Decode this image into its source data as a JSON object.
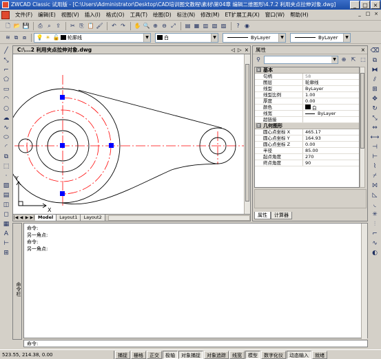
{
  "window": {
    "title": "ZWCAD Classic 试用版 - [C:\\Users\\Administrator\\Desktop\\CAD培训图文教程\\素材\\第04章 编辑二维图形\\4.7.2    利用夹点拉伸对象.dwg]",
    "controls": [
      "_",
      "□",
      "×"
    ]
  },
  "menu": {
    "items": [
      "文件(F)",
      "编辑(E)",
      "视图(V)",
      "插入(I)",
      "格式(O)",
      "工具(T)",
      "绘图(D)",
      "标注(N)",
      "修改(M)",
      "ET扩展工具(X)",
      "窗口(W)",
      "帮助(H)"
    ],
    "mdi_controls": [
      "_",
      "□",
      "×"
    ]
  },
  "toolbar": {
    "layer": "轮廓线",
    "color": "白",
    "linetype": "ByLayer",
    "lineweight": "ByLayer"
  },
  "document": {
    "tab_label": "C:\\...2  利用夹点拉伸对象.dwg",
    "controls": [
      "◁",
      "▷",
      "×"
    ]
  },
  "layouts": {
    "tabs": [
      "Model",
      "Layout1",
      "Layout2"
    ],
    "active": "Model"
  },
  "ucs": {
    "x_label": "X",
    "y_label": "Y"
  },
  "properties": {
    "title": "属性",
    "selection": "",
    "sections": [
      {
        "name": "基本",
        "toggle": "⊟",
        "rows": [
          {
            "key": "句柄",
            "value": "58",
            "muted": true
          },
          {
            "key": "图层",
            "value": "轮廓线"
          },
          {
            "key": "线型",
            "value": "ByLayer"
          },
          {
            "key": "线型比例",
            "value": "1.00"
          },
          {
            "key": "厚度",
            "value": "0.00"
          },
          {
            "key": "颜色",
            "value": "白",
            "swatch": "#000000"
          },
          {
            "key": "线宽",
            "value": "ByLayer",
            "line": true
          },
          {
            "key": "超链接",
            "value": ""
          }
        ]
      },
      {
        "name": "几何图形",
        "toggle": "⊟",
        "rows": [
          {
            "key": "圆心点坐标 X",
            "value": "465.17"
          },
          {
            "key": "圆心点坐标 Y",
            "value": "164.93"
          },
          {
            "key": "圆心点坐标 Z",
            "value": "0.00"
          },
          {
            "key": "半径",
            "value": "85.00"
          },
          {
            "key": "起点角度",
            "value": "270"
          },
          {
            "key": "终点角度",
            "value": "90"
          }
        ]
      }
    ],
    "tabs": [
      "属性",
      "计算器"
    ],
    "active_tab": "属性"
  },
  "command": {
    "side_label": "命令栏",
    "history": [
      "命令:",
      "另一角点:",
      "命令:",
      "另一角点:"
    ],
    "prompt": "命令:"
  },
  "status": {
    "coords": "523.55,  214.38,  0.00",
    "buttons": [
      {
        "label": "捕捉",
        "on": false
      },
      {
        "label": "栅格",
        "on": false
      },
      {
        "label": "正交",
        "on": false
      },
      {
        "label": "极轴",
        "on": true
      },
      {
        "label": "对象捕捉",
        "on": true
      },
      {
        "label": "对象追踪",
        "on": false
      },
      {
        "label": "线宽",
        "on": false
      },
      {
        "label": "模型",
        "on": true
      },
      {
        "label": "数字化仪",
        "on": false
      },
      {
        "label": "动态输入",
        "on": true
      },
      {
        "label": "就绪",
        "on": false
      }
    ]
  },
  "colors": {
    "titlebar": "#1d4fa8",
    "drawing_line": "#000000",
    "center_line": "#ff0000",
    "grip": "#0000ff"
  }
}
